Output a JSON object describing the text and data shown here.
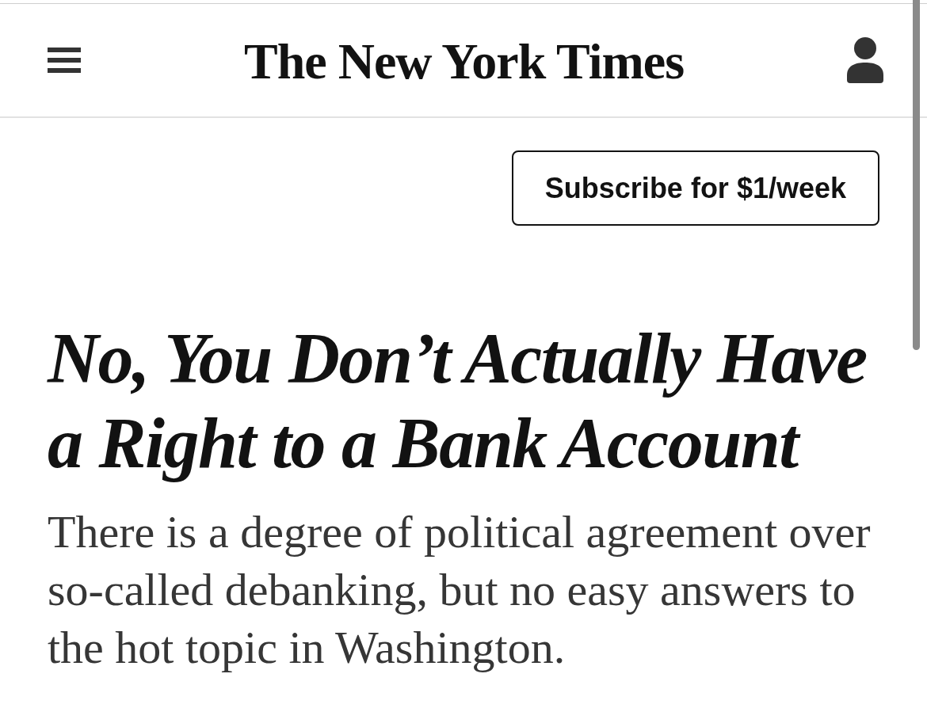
{
  "header": {
    "masthead": "The New York Times"
  },
  "subscribe_button": {
    "label": "Subscribe for $1/week"
  },
  "article": {
    "headline": "No, You Don’t Actually Have a Right to a Bank Account",
    "summary": "There is a degree of political agreement over so-called debanking, but no easy answers to the hot topic in Washington."
  }
}
